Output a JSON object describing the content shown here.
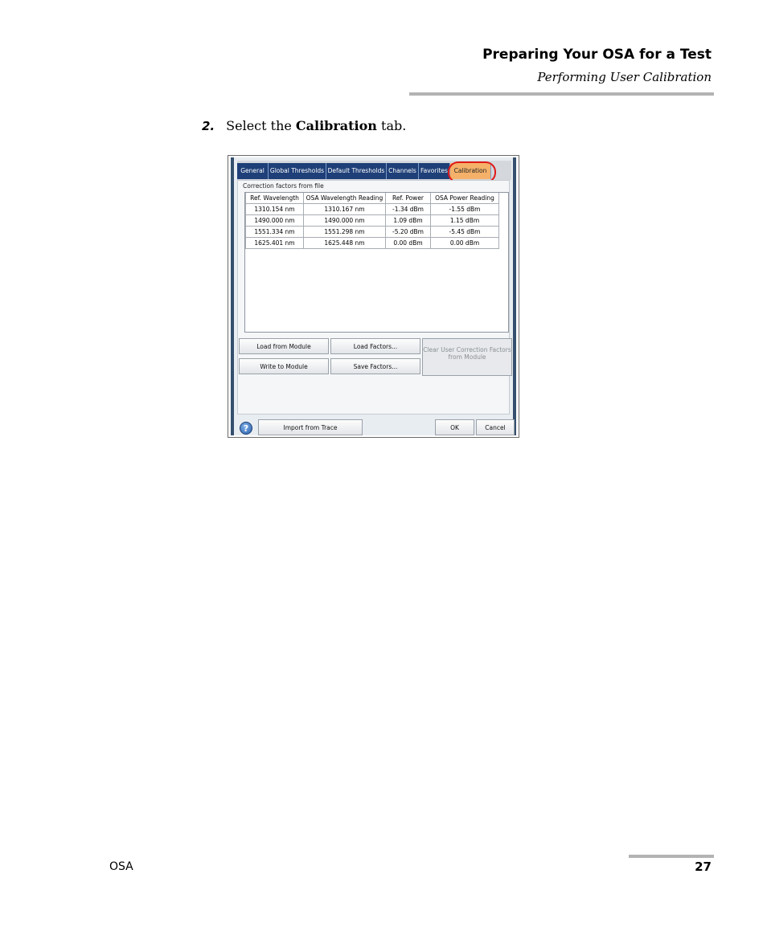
{
  "header": {
    "title": "Preparing Your OSA for a Test",
    "subtitle": "Performing User Calibration"
  },
  "step": {
    "number": "2.",
    "text_before": "Select the ",
    "text_bold": "Calibration",
    "text_after": " tab."
  },
  "dialog": {
    "tabs": [
      "General",
      "Global Thresholds",
      "Default Thresholds",
      "Channels",
      "Favorites",
      "Calibration"
    ],
    "active_tab": "Calibration",
    "group_label": "Correction factors from file",
    "table": {
      "columns": [
        "Ref. Wavelength",
        "OSA Wavelength Reading",
        "Ref. Power",
        "OSA Power Reading"
      ],
      "rows": [
        [
          "1310.154 nm",
          "1310.167 nm",
          "-1.34 dBm",
          "-1.55 dBm"
        ],
        [
          "1490.000 nm",
          "1490.000 nm",
          "1.09 dBm",
          "1.15 dBm"
        ],
        [
          "1551.334 nm",
          "1551.298 nm",
          "-5.20 dBm",
          "-5.45 dBm"
        ],
        [
          "1625.401 nm",
          "1625.448 nm",
          "0.00 dBm",
          "0.00 dBm"
        ]
      ]
    },
    "buttons": {
      "load_from_module": "Load from Module",
      "load_factors": "Load Factors...",
      "write_to_module": "Write to Module",
      "save_factors": "Save Factors...",
      "clear_user_factors": "Clear User Correction Factors from Module",
      "import_from_trace": "Import from Trace",
      "ok": "OK",
      "cancel": "Cancel",
      "help": "?"
    },
    "highlight_color": "#e01818"
  },
  "footer": {
    "left": "OSA",
    "page_number": "27"
  }
}
